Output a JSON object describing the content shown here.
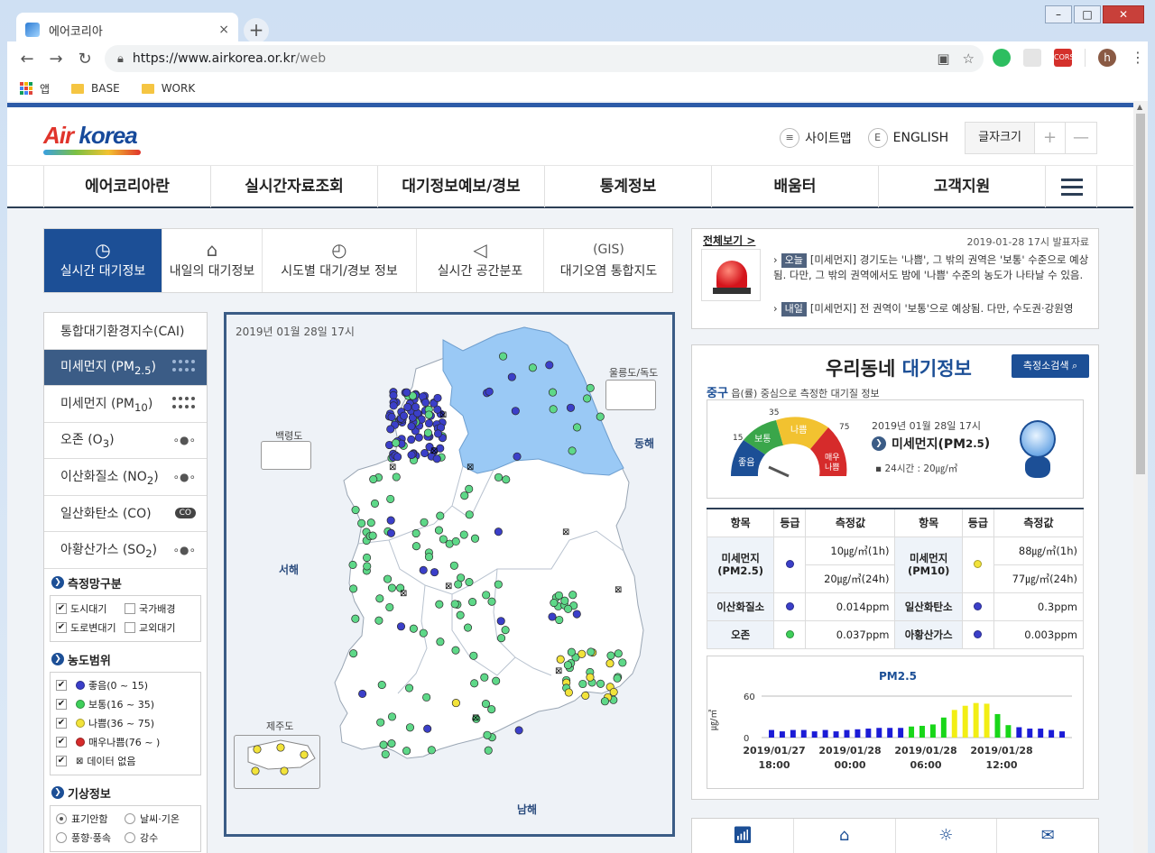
{
  "browser": {
    "tab_title": "에어코리아",
    "tab_close": "×",
    "new_tab": "+",
    "url_main": "https://www.airkorea.or.kr",
    "url_path": "/web",
    "bookmarks": [
      "앱",
      "BASE",
      "WORK"
    ],
    "avatar_letter": "h",
    "ext_cors": "CORS"
  },
  "header": {
    "logo_air": "Air",
    "logo_korea": "korea",
    "sitemap": "사이트맵",
    "english": "ENGLISH",
    "english_icon": "E",
    "fontsize": "글자크기",
    "plus": "+",
    "minus": "—"
  },
  "gnb": [
    "에어코리아란",
    "실시간자료조회",
    "대기정보예보/경보",
    "통계정보",
    "배움터",
    "고객지원"
  ],
  "subtabs": [
    {
      "label": "실시간 대기정보",
      "icon": "◷"
    },
    {
      "label": "내일의 대기정보",
      "icon": "⌂"
    },
    {
      "label": "시도별 대기/경보 정보",
      "icon": "◴"
    },
    {
      "label": "실시간 공간분포",
      "icon": "◁"
    },
    {
      "label": "대기오염 통합지도",
      "icon": "(GIS)"
    }
  ],
  "leftnav": {
    "items": [
      {
        "label": "통합대기환경지수(CAI)"
      },
      {
        "label": "미세먼지 (PM",
        "sub": "2.5",
        "after": ")"
      },
      {
        "label": "미세먼지 (PM",
        "sub": "10",
        "after": ")"
      },
      {
        "label": "오존 (O",
        "sub": "3",
        "after": ")"
      },
      {
        "label": "이산화질소 (NO",
        "sub": "2",
        "after": ")"
      },
      {
        "label": "일산화탄소 (CO)"
      },
      {
        "label": "아황산가스 (SO",
        "sub": "2",
        "after": ")"
      }
    ],
    "network_title": "측정망구분",
    "network": [
      "도시대기",
      "국가배경",
      "도로변대기",
      "교외대기"
    ],
    "range_title": "농도범위",
    "ranges": [
      {
        "label": "좋음(0 ~ 15)",
        "color": "#3b3fc9"
      },
      {
        "label": "보통(16 ~ 35)",
        "color": "#3ecf5a"
      },
      {
        "label": "나쁨(36 ~ 75)",
        "color": "#f2e33a"
      },
      {
        "label": "매우나쁨(76 ~ )",
        "color": "#d62b2b"
      },
      {
        "label": "데이터 없음",
        "color": "none"
      }
    ],
    "weather_title": "기상정보",
    "weather": [
      "표기안함",
      "날씨·기온",
      "풍향·풍속",
      "강수"
    ]
  },
  "map": {
    "date": "2019년 01월 28일 17시",
    "baengnyeong": "백령도",
    "ulleung": "울릉도/독도",
    "jeju": "제주도",
    "east_sea": "동해",
    "west_sea": "서해",
    "south_sea": "남해",
    "co_badge": "CO"
  },
  "news": {
    "head": "전체보기 >",
    "date": "2019-01-28 17시 발표자료",
    "today_badge": "오늘",
    "today_text": "[미세먼지] 경기도는 '나쁨', 그 밖의 권역은 '보통' 수준으로 예상됨. 다만, 그 밖의 권역에서도 밤에 '나쁨' 수준의 농도가 나타날 수 있음.",
    "tomorrow_badge": "내일",
    "tomorrow_text": "[미세먼지] 전 권역이 '보통'으로 예상됨. 다만, 수도권·강원영"
  },
  "dong": {
    "title_a": "우리동네",
    "title_b": "대기정보",
    "search": "측정소검색",
    "district": "중구",
    "sub_text": "읍(률) 중심으로 측정한 대기질 정보",
    "gauge_date": "2019년 01월 28일 17시",
    "gauge_item": "미세먼지(PM",
    "gauge_item_sub": "2.5",
    "gauge_item_after": ")",
    "gauge_24": "▪ 24시간 : 20㎍/㎥",
    "gauge_labels": {
      "good": "좋음",
      "normal": "보통",
      "bad": "나쁨",
      "verybad": "매우\n나쁨",
      "t15": "15",
      "t35": "35",
      "t75": "75"
    },
    "table": {
      "headers": [
        "항목",
        "등급",
        "측정값",
        "항목",
        "등급",
        "측정값"
      ],
      "pm25_name": "미세먼지",
      "pm25_sub": "(PM2.5)",
      "pm25_1h": "10㎍/㎥(1h)",
      "pm25_24h": "20㎍/㎥(24h)",
      "pm10_name": "미세먼지",
      "pm10_sub": "(PM10)",
      "pm10_1h": "88㎍/㎥(1h)",
      "pm10_24h": "77㎍/㎥(24h)",
      "no2_name": "이산화질소",
      "no2_val": "0.014ppm",
      "co_name": "일산화탄소",
      "co_val": "0.3ppm",
      "o3_name": "오존",
      "o3_val": "0.037ppm",
      "so2_name": "아황산가스",
      "so2_val": "0.003ppm"
    }
  },
  "chart_data": {
    "type": "bar",
    "title": "PM2.5",
    "ylabel": "㎍/㎥",
    "ylim": [
      0,
      60
    ],
    "yticks": [
      0,
      60
    ],
    "x_labels": [
      "2019/01/27\n18:00",
      "2019/01/28\n00:00",
      "2019/01/28\n06:00",
      "2019/01/28\n12:00"
    ],
    "values": [
      11,
      9,
      11,
      11,
      9,
      11,
      9,
      11,
      12,
      13,
      14,
      14,
      14,
      16,
      17,
      19,
      29,
      40,
      46,
      50,
      49,
      34,
      18,
      15,
      13,
      13,
      11,
      9
    ],
    "colors": [
      "#1b1bd6",
      "#1b1bd6",
      "#1b1bd6",
      "#1b1bd6",
      "#1b1bd6",
      "#1b1bd6",
      "#1b1bd6",
      "#1b1bd6",
      "#1b1bd6",
      "#1b1bd6",
      "#1b1bd6",
      "#1b1bd6",
      "#1b1bd6",
      "#19d619",
      "#19d619",
      "#19d619",
      "#19d619",
      "#f2ee15",
      "#f2ee15",
      "#f2ee15",
      "#f2ee15",
      "#19d619",
      "#19d619",
      "#1b1bd6",
      "#1b1bd6",
      "#1b1bd6",
      "#1b1bd6",
      "#1b1bd6"
    ]
  }
}
